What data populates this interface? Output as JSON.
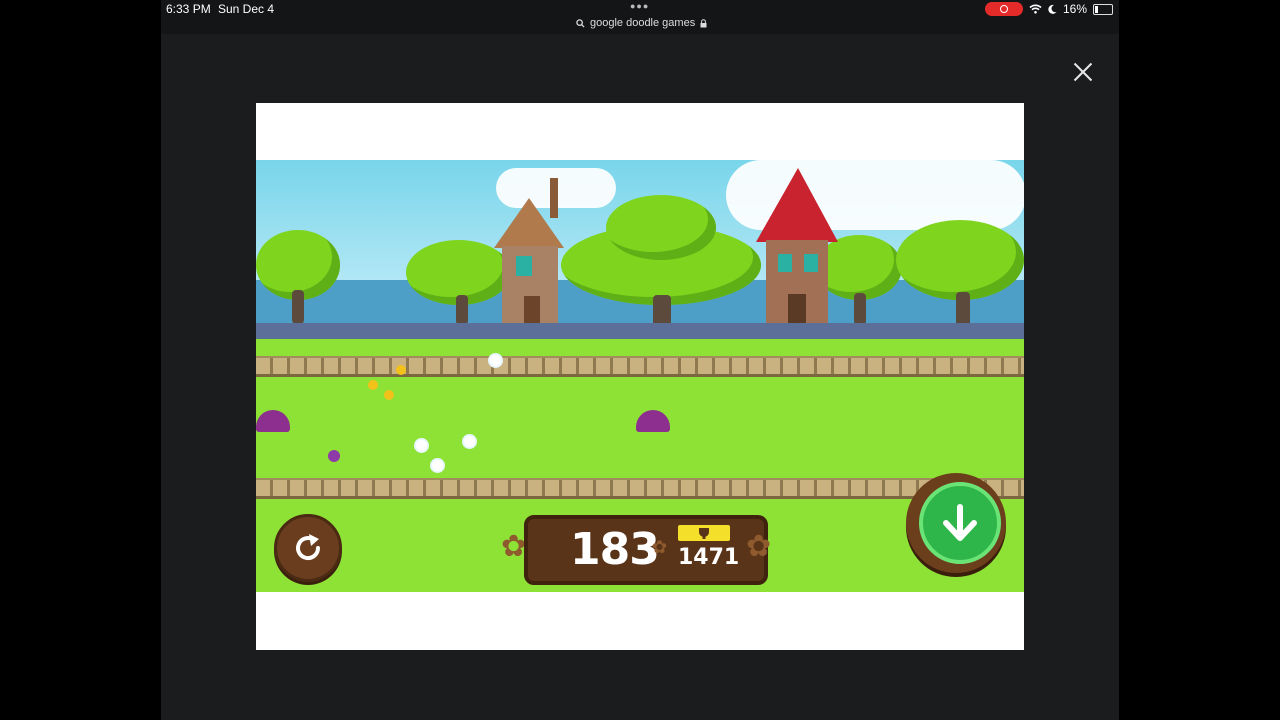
{
  "status_bar": {
    "time": "6:33 PM",
    "date": "Sun Dec 4",
    "url": "google doodle games",
    "battery": "16%"
  },
  "icons": {
    "close": "close-icon",
    "search": "search-icon",
    "lock": "lock-icon",
    "wifi": "wifi-icon",
    "moon": "moon-icon",
    "restart": "restart-icon",
    "down": "arrow-down-icon",
    "trophy": "trophy-icon"
  },
  "game": {
    "score": "183",
    "best_score": "1471"
  },
  "colors": {
    "grass": "#8ee236",
    "sky": "#78d5ea",
    "wood": "#5a3418",
    "button_green": "#2fb64a",
    "record_red": "#e52a2a"
  }
}
